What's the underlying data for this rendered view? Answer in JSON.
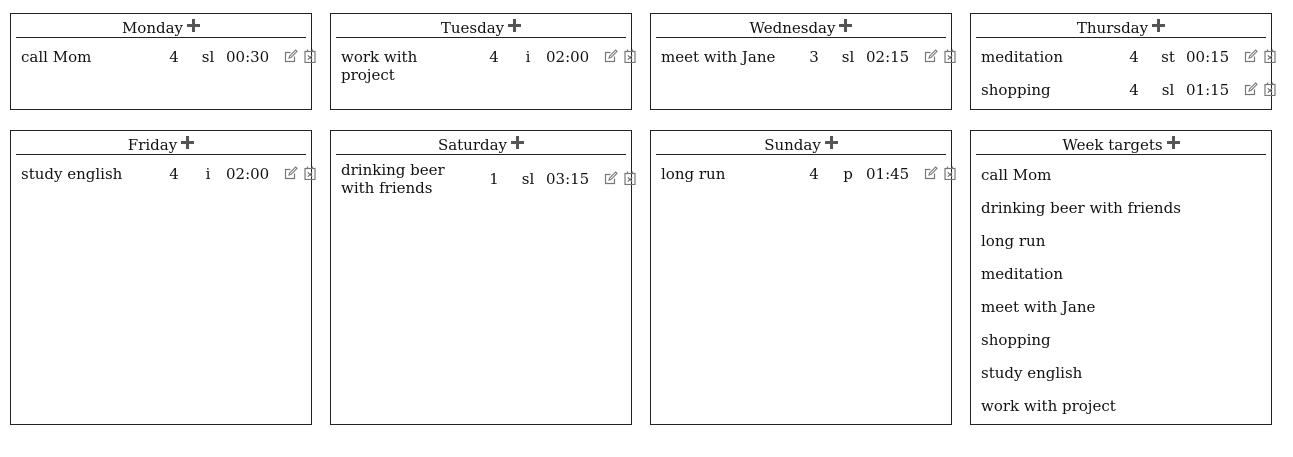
{
  "days": [
    {
      "title": "Monday",
      "tasks": [
        {
          "name": "call Mom",
          "num": "4",
          "type": "sl",
          "time": "00:30"
        }
      ]
    },
    {
      "title": "Tuesday",
      "tasks": [
        {
          "name": "work with project",
          "num": "4",
          "type": "i",
          "time": "02:00"
        }
      ]
    },
    {
      "title": "Wednesday",
      "tasks": [
        {
          "name": "meet with Jane",
          "num": "3",
          "type": "sl",
          "time": "02:15"
        }
      ]
    },
    {
      "title": "Thursday",
      "tasks": [
        {
          "name": "meditation",
          "num": "4",
          "type": "st",
          "time": "00:15"
        },
        {
          "name": "shopping",
          "num": "4",
          "type": "sl",
          "time": "01:15"
        }
      ]
    },
    {
      "title": "Friday",
      "tasks": [
        {
          "name": "study english",
          "num": "4",
          "type": "i",
          "time": "02:00"
        }
      ]
    },
    {
      "title": "Saturday",
      "tasks": [
        {
          "name": "drinking beer with friends",
          "num": "1",
          "type": "sl",
          "time": "03:15"
        }
      ]
    },
    {
      "title": "Sunday",
      "tasks": [
        {
          "name": "long run",
          "num": "4",
          "type": "p",
          "time": "01:45"
        }
      ]
    }
  ],
  "week_targets": {
    "title": "Week targets",
    "items": [
      "call Mom",
      "drinking beer with friends",
      "long run",
      "meditation",
      "meet with Jane",
      "shopping",
      "study english",
      "work with project"
    ]
  },
  "icons": {
    "add": "plus-icon",
    "edit": "edit-icon",
    "delete": "delete-icon"
  }
}
